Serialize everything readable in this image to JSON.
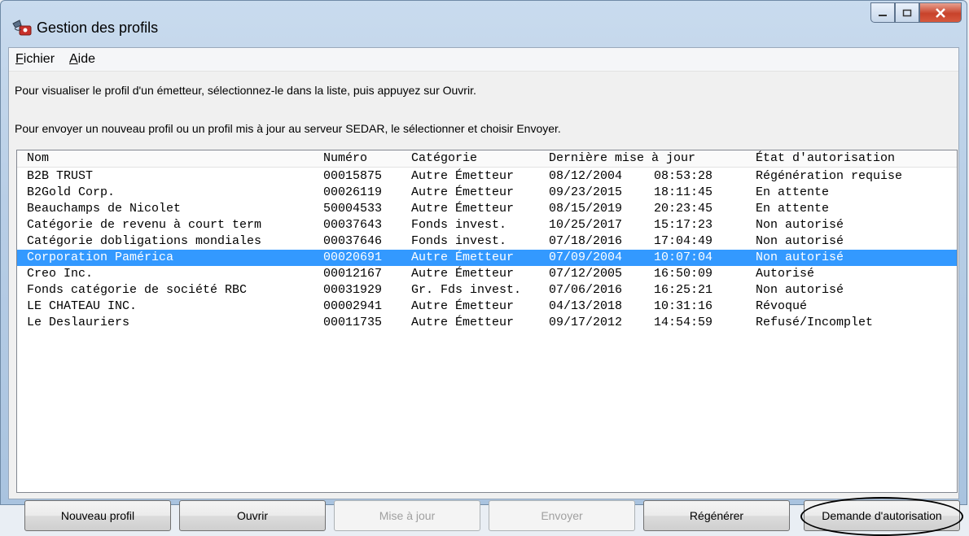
{
  "window": {
    "title": "Gestion des profils"
  },
  "menu": [
    {
      "accel": "F",
      "rest": "ichier"
    },
    {
      "accel": "A",
      "rest": "ide"
    }
  ],
  "info": {
    "line1": "Pour visualiser le profil d'un émetteur, sélectionnez-le dans la liste, puis appuyez sur Ouvrir.",
    "line2": "Pour envoyer un nouveau profil ou un profil mis à jour au serveur SEDAR, le sélectionner et choisir Envoyer."
  },
  "columns": {
    "nom": "Nom",
    "numero": "Numéro",
    "categorie": "Catégorie",
    "maj": "Dernière mise à jour",
    "etat": "État d'autorisation"
  },
  "rows": [
    {
      "nom": "B2B TRUST",
      "numero": "00015875",
      "categorie": "Autre Émetteur",
      "date": "08/12/2004",
      "heure": "08:53:28",
      "etat": "Régénération requise"
    },
    {
      "nom": "B2Gold Corp.",
      "numero": "00026119",
      "categorie": "Autre Émetteur",
      "date": "09/23/2015",
      "heure": "18:11:45",
      "etat": "En attente"
    },
    {
      "nom": "Beauchamps de Nicolet",
      "numero": "50004533",
      "categorie": "Autre Émetteur",
      "date": "08/15/2019",
      "heure": "20:23:45",
      "etat": "En attente"
    },
    {
      "nom": "Catégorie de revenu à court term",
      "numero": "00037643",
      "categorie": "Fonds invest.",
      "date": "10/25/2017",
      "heure": "15:17:23",
      "etat": "Non autorisé"
    },
    {
      "nom": "Catégorie dobligations mondiales",
      "numero": "00037646",
      "categorie": "Fonds invest.",
      "date": "07/18/2016",
      "heure": "17:04:49",
      "etat": "Non autorisé"
    },
    {
      "nom": "Corporation Pamérica",
      "numero": "00020691",
      "categorie": "Autre Émetteur",
      "date": "07/09/2004",
      "heure": "10:07:04",
      "etat": "Non autorisé"
    },
    {
      "nom": "Creo Inc.",
      "numero": "00012167",
      "categorie": "Autre Émetteur",
      "date": "07/12/2005",
      "heure": "16:50:09",
      "etat": "Autorisé"
    },
    {
      "nom": "Fonds catégorie de société RBC",
      "numero": "00031929",
      "categorie": "Gr. Fds invest.",
      "date": "07/06/2016",
      "heure": "16:25:21",
      "etat": "Non autorisé"
    },
    {
      "nom": "LE CHATEAU INC.",
      "numero": "00002941",
      "categorie": "Autre Émetteur",
      "date": "04/13/2018",
      "heure": "10:31:16",
      "etat": "Révoqué"
    },
    {
      "nom": "Le Deslauriers",
      "numero": "00011735",
      "categorie": "Autre Émetteur",
      "date": "09/17/2012",
      "heure": "14:54:59",
      "etat": "Refusé/Incomplet"
    }
  ],
  "selected_row": 5,
  "buttons": {
    "nouveau": "Nouveau profil",
    "ouvrir": "Ouvrir",
    "mise_a_jour": "Mise à jour",
    "envoyer": "Envoyer",
    "regenerer": "Régénérer",
    "demande": "Demande d'autorisation"
  },
  "colors": {
    "selection": "#3399ff",
    "highlight_oval": "#000000"
  }
}
